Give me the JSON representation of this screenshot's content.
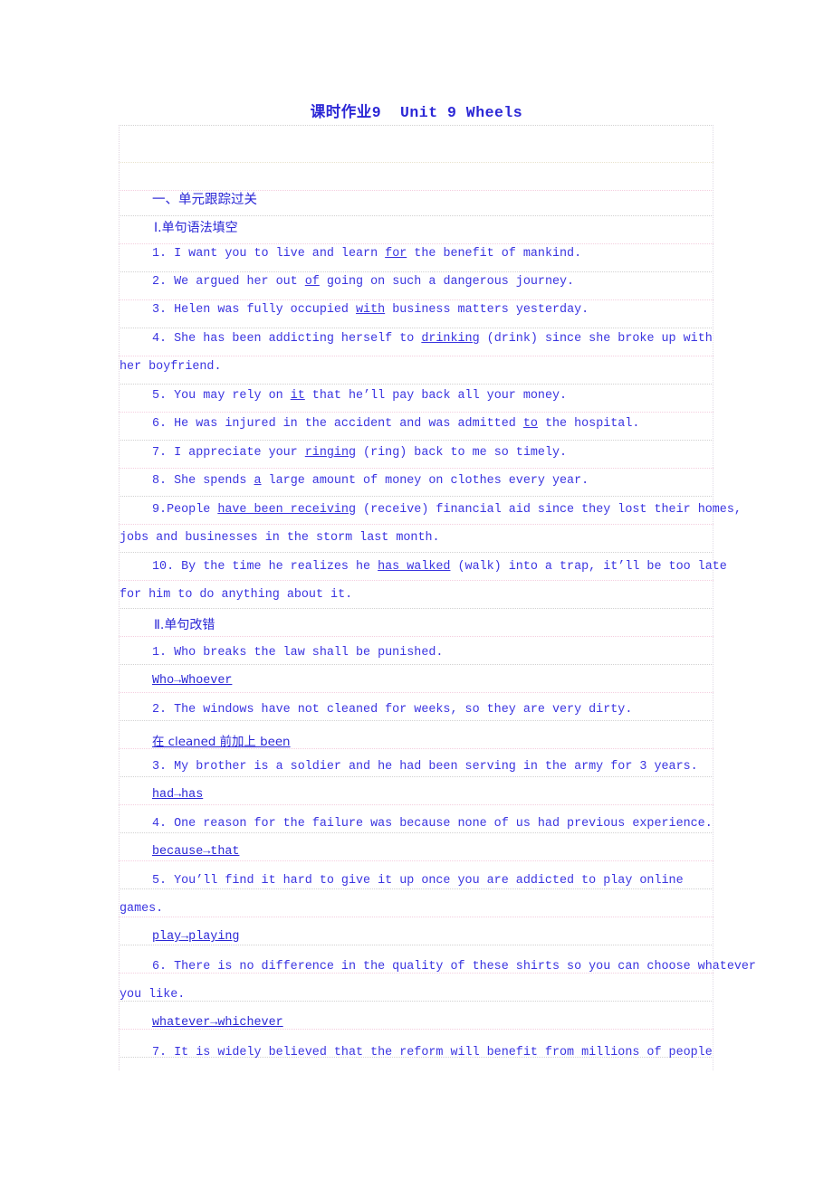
{
  "document": {
    "title_cn": "课时作业",
    "title_num": "9",
    "title_en": "Unit 9  Wheels",
    "title_full": "课时作业9  Unit 9  Wheels"
  },
  "section": {
    "heading": "一、单元跟踪过关"
  },
  "part1": {
    "heading": "Ⅰ.单句语法填空",
    "items": [
      {
        "num": "1.",
        "pre": " I want you to live and learn ",
        "answer": "for",
        "post": " the benefit of mankind."
      },
      {
        "num": "2.",
        "pre": " We argued her out ",
        "answer": "of",
        "post": " going on such a dangerous journey."
      },
      {
        "num": "3.",
        "pre": " Helen was fully occupied ",
        "answer": "with",
        "post": " business matters yesterday."
      },
      {
        "num": "4.",
        "pre": " She has been addicting herself to ",
        "answer": "drinking",
        "post": " (drink) since she broke up with",
        "cont": "her boyfriend."
      },
      {
        "num": "5.",
        "pre": " You may rely on ",
        "answer": "it",
        "post": " that he’ll pay back all your money."
      },
      {
        "num": "6.",
        "pre": " He was injured in the accident and was admitted ",
        "answer": "to",
        "post": " the hospital."
      },
      {
        "num": "7.",
        "pre": " I appreciate your ",
        "answer": "ringing",
        "post": " (ring) back to me so timely."
      },
      {
        "num": "8.",
        "pre": " She spends ",
        "answer": "a",
        "post": " large amount of money on clothes every year."
      },
      {
        "num": "9.",
        "pre": "People ",
        "answer": "have been receiving",
        "post": " (receive) financial aid since they lost their homes,",
        "cont": "jobs and businesses in the storm last month."
      },
      {
        "num": "10.",
        "pre": " By the time he realizes he ",
        "answer": "has walked",
        "post": " (walk) into a trap, it’ll be too late",
        "cont": "for him to do anything about it."
      }
    ]
  },
  "part2": {
    "heading": "Ⅱ.单句改错",
    "items": [
      {
        "num": "1.",
        "sentence": " Who breaks the law shall be punished.",
        "answer": "Who→Whoever"
      },
      {
        "num": "2.",
        "sentence": " The windows have not cleaned for weeks, so they are very dirty.",
        "answer": "在 cleaned 前加上 been"
      },
      {
        "num": "3.",
        "sentence": " My brother is a soldier and he had been serving in the army for 3 years.",
        "answer": "had→has"
      },
      {
        "num": "4.",
        "sentence": " One reason for the failure was because none of us had previous experience.",
        "answer": "because→that"
      },
      {
        "num": "5.",
        "sentence": " You’ll find it hard to give it up once you are addicted to play online",
        "cont": "games.",
        "answer": "play→playing"
      },
      {
        "num": "6.",
        "sentence": " There is no difference in the quality of these shirts so you can choose whatever",
        "cont": "you like.",
        "answer": "whatever→whichever"
      },
      {
        "num": "7.",
        "sentence": " It is widely believed that the reform will benefit from millions of people",
        "cont": "",
        "answer": ""
      }
    ]
  },
  "colors": {
    "text_blue": "#3a34e0",
    "heading_blue": "#2b27d6",
    "grid_gray": "#cfcfcf",
    "grid_pink": "#f3c6da",
    "grid_tan": "#e4ddc4"
  }
}
